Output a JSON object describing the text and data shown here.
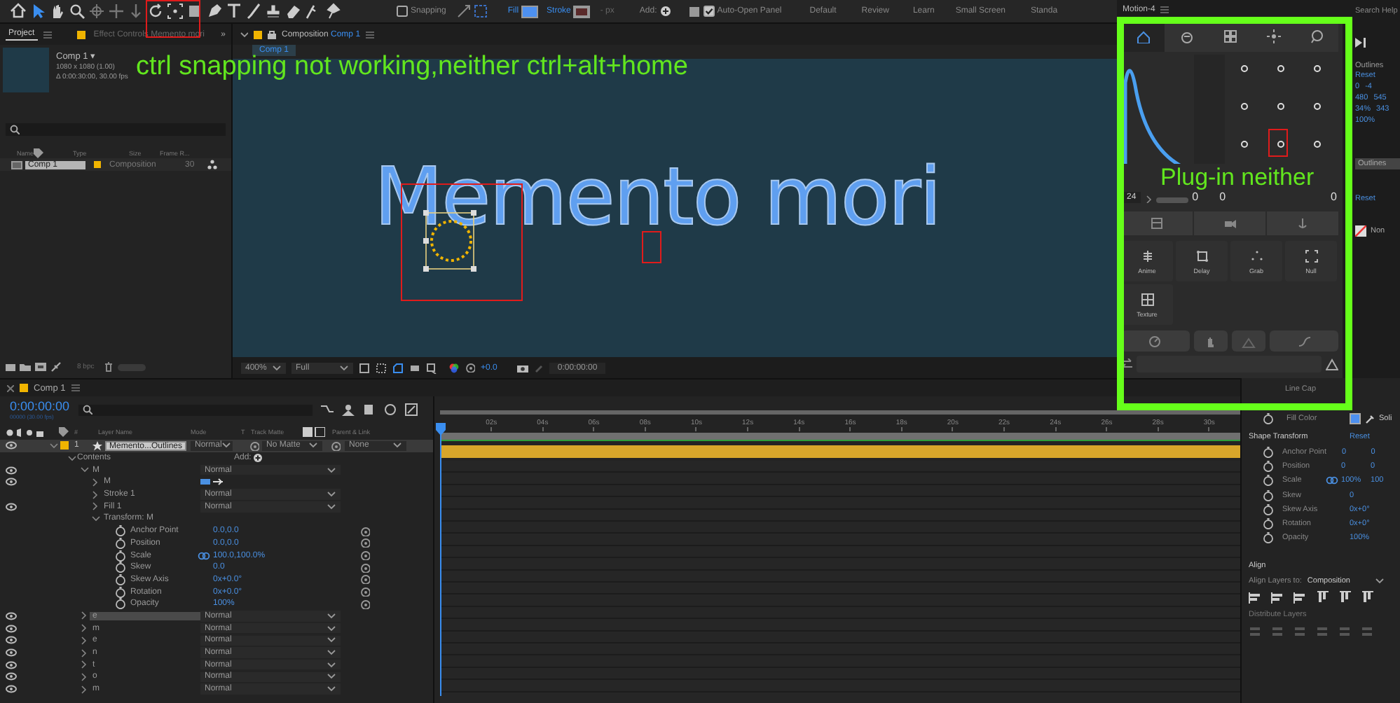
{
  "toolbar": {
    "snapping": {
      "label": "Snapping",
      "checked": false
    },
    "fill_label": "Fill",
    "stroke_label": "Stroke",
    "stroke_width": "- px",
    "add_label": "Add:",
    "auto_open": {
      "label": "Auto-Open Panel",
      "checked": true
    },
    "workspaces": [
      {
        "label": "Default",
        "selected": false
      },
      {
        "label": "Review",
        "selected": false
      },
      {
        "label": "Learn",
        "selected": false
      },
      {
        "label": "Small Screen",
        "selected": false
      },
      {
        "label": "Standa",
        "selected": false
      }
    ]
  },
  "project": {
    "tabs": [
      {
        "label": "Project",
        "selected": true
      },
      {
        "label": "Effect Controls Memento mori",
        "selected": false
      }
    ],
    "overflow": "»",
    "comp_name": "Comp 1 ▾",
    "comp_size": "1080 x 1080 (1.00)",
    "comp_duration": "Δ 0:00:30:00, 30.00 fps",
    "columns": [
      "Name",
      "Type",
      "Size",
      "Frame R..."
    ],
    "items": [
      {
        "name": "Comp 1",
        "type": "Composition",
        "frame_rate": "30",
        "selected": true
      }
    ],
    "bpc": "8 bpc"
  },
  "composition": {
    "tab_label": "Composition",
    "tab_comp": "Comp 1",
    "viewer_tab": "Comp 1",
    "text": "Memento mori",
    "zoom": "400%",
    "resolution": "Full",
    "exposure": "+0.0",
    "timecode": "0:00:00:00"
  },
  "annotations": {
    "note": "ctrl snapping not working,neither ctrl+alt+home",
    "plugin_note": "Plug-in neither"
  },
  "motion": {
    "title": "Motion-4",
    "tabs": [
      {
        "selected": true
      },
      {
        "selected": false
      },
      {
        "selected": false
      },
      {
        "selected": false
      },
      {
        "selected": false
      }
    ],
    "frames": "24",
    "values": [
      "0",
      "0",
      "0"
    ],
    "tools": [
      {
        "label": "Anime"
      },
      {
        "label": "Delay"
      },
      {
        "label": "Grab"
      },
      {
        "label": "Null"
      },
      {
        "label": "Texture"
      }
    ]
  },
  "side_strip": {
    "search_help": "Search Help",
    "outlines": "Outlines",
    "reset": "Reset",
    "values": [
      [
        "0",
        "-4"
      ],
      [
        "480",
        "545"
      ],
      [
        "34%",
        "343"
      ],
      [
        "100%"
      ]
    ],
    "outlines_bar": "Outlines",
    "reset_2": "Reset",
    "blend": "Non"
  },
  "timeline": {
    "tab": "Comp 1",
    "time": "0:00:00:00",
    "fps": "00000 (30.00 fps)",
    "columns": {
      "number": "#",
      "name": "Layer Name",
      "mode": "Mode",
      "t": "T",
      "matte": "Track Matte",
      "parent": "Parent & Link"
    },
    "layer": {
      "number": "1",
      "name": "Memento...Outlines",
      "mode": "Normal",
      "matte": "No Matte",
      "parent": "None",
      "selected": true,
      "visible": true,
      "expanded": true
    },
    "contents_label": "Contents",
    "add_label": "Add:",
    "groups": [
      {
        "kind": "group",
        "name": "M",
        "mode": "Normal",
        "visible": true,
        "expanded": true,
        "selected": false,
        "children": [
          {
            "kind": "path",
            "name": "M",
            "visible": true,
            "expanded": false,
            "selected": false
          },
          {
            "kind": "group",
            "name": "Stroke 1",
            "mode": "Normal",
            "visible": false,
            "expanded": false,
            "selected": false
          },
          {
            "kind": "group",
            "name": "Fill 1",
            "mode": "Normal",
            "visible": true,
            "expanded": false,
            "selected": false
          },
          {
            "kind": "transform",
            "name": "Transform: M",
            "visible": false,
            "expanded": true,
            "selected": false,
            "properties": [
              {
                "name": "Anchor Point",
                "value": "0.0,0.0",
                "linked": false
              },
              {
                "name": "Position",
                "value": "0.0,0.0",
                "linked": false
              },
              {
                "name": "Scale",
                "value": "100.0,100.0%",
                "linked": true
              },
              {
                "name": "Skew",
                "value": "0.0",
                "linked": false
              },
              {
                "name": "Skew Axis",
                "value": "0x+0.0°",
                "linked": false
              },
              {
                "name": "Rotation",
                "value": "0x+0.0°",
                "linked": false
              },
              {
                "name": "Opacity",
                "value": "100%",
                "linked": false
              }
            ]
          }
        ]
      },
      {
        "kind": "group",
        "name": "e",
        "mode": "Normal",
        "visible": true,
        "expanded": false,
        "selected": true
      },
      {
        "kind": "group",
        "name": "m",
        "mode": "Normal",
        "visible": true,
        "expanded": false,
        "selected": false
      },
      {
        "kind": "group",
        "name": "e",
        "mode": "Normal",
        "visible": true,
        "expanded": false,
        "selected": false
      },
      {
        "kind": "group",
        "name": "n",
        "mode": "Normal",
        "visible": true,
        "expanded": false,
        "selected": false
      },
      {
        "kind": "group",
        "name": "t",
        "mode": "Normal",
        "visible": true,
        "expanded": false,
        "selected": false
      },
      {
        "kind": "group",
        "name": "o",
        "mode": "Normal",
        "visible": true,
        "expanded": false,
        "selected": false
      },
      {
        "kind": "group",
        "name": "m",
        "mode": "Normal",
        "visible": true,
        "expanded": false,
        "selected": false
      }
    ],
    "ruler": [
      "02s",
      "04s",
      "06s",
      "08s",
      "10s",
      "12s",
      "14s",
      "16s",
      "18s",
      "20s",
      "22s",
      "24s",
      "26s",
      "28s",
      "30s"
    ]
  },
  "properties": {
    "line_cap": "Line Cap",
    "fill_color": "Fill Color",
    "fill_type": "Soli",
    "title": "Shape Transform",
    "reset": "Reset",
    "items": [
      {
        "name": "Anchor Point",
        "values": [
          "0",
          "0"
        ],
        "linked": false
      },
      {
        "name": "Position",
        "values": [
          "0",
          "0"
        ],
        "linked": false
      },
      {
        "name": "Scale",
        "values": [
          "100%",
          "100"
        ],
        "linked": true
      },
      {
        "name": "Skew",
        "values": [
          "0"
        ],
        "linked": false
      },
      {
        "name": "Skew Axis",
        "values": [
          "0x+0°"
        ],
        "linked": false
      },
      {
        "name": "Rotation",
        "values": [
          "0x+0°"
        ],
        "linked": false
      },
      {
        "name": "Opacity",
        "values": [
          "100%"
        ],
        "linked": false
      }
    ],
    "align_title": "Align",
    "align_to_label": "Align Layers to:",
    "align_to": "Composition",
    "distribute_label": "Distribute Layers"
  }
}
